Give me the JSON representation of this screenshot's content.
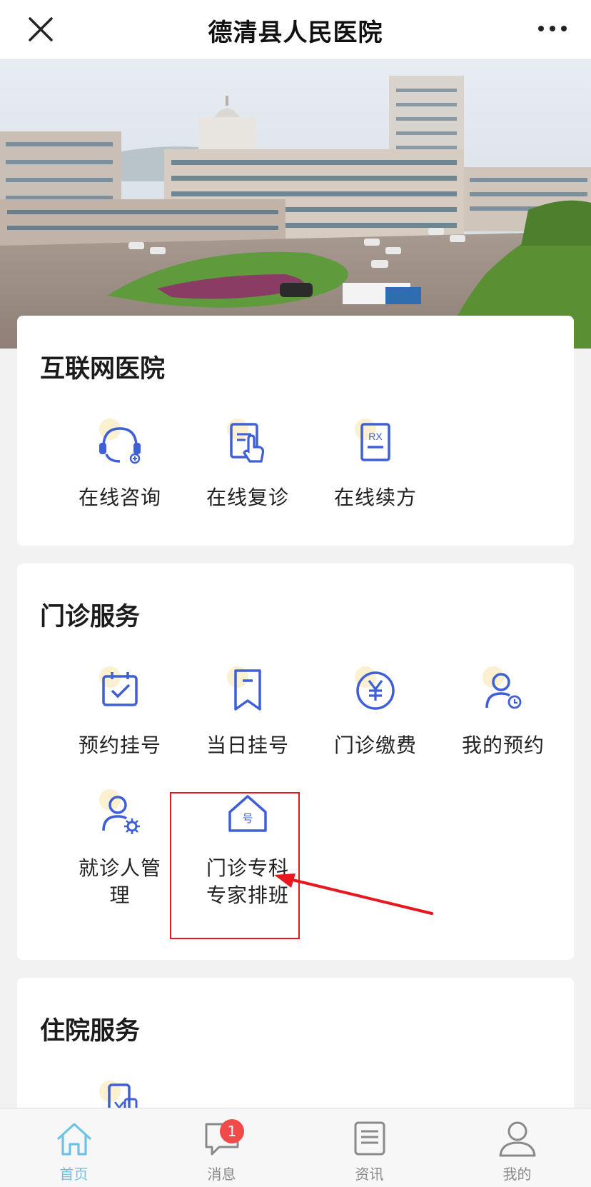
{
  "header": {
    "title": "德清县人民医院",
    "close_icon": "close-icon",
    "more_icon": "more-icon"
  },
  "banner": {
    "alt": "hospital-building-photo"
  },
  "internet_hospital": {
    "title": "互联网医院",
    "items": [
      {
        "label": "在线咨询",
        "icon": "headset-icon"
      },
      {
        "label": "在线复诊",
        "icon": "document-touch-icon"
      },
      {
        "label": "在线续方",
        "icon": "prescription-rx-icon"
      }
    ]
  },
  "outpatient": {
    "title": "门诊服务",
    "items": [
      {
        "label": "预约挂号",
        "icon": "calendar-check-icon"
      },
      {
        "label": "当日挂号",
        "icon": "bookmark-icon"
      },
      {
        "label": "门诊缴费",
        "icon": "yuan-coin-icon"
      },
      {
        "label": "我的预约",
        "icon": "user-clock-icon"
      },
      {
        "label": "就诊人管理",
        "icon": "user-gear-icon"
      },
      {
        "label": "门诊专科专家排班",
        "icon": "house-number-icon",
        "glyph": "号"
      }
    ]
  },
  "inpatient": {
    "title": "住院服务",
    "items": [
      {
        "icon": "phone-yuan-icon"
      }
    ]
  },
  "tabbar": {
    "tabs": [
      {
        "label": "首页",
        "icon": "home-icon",
        "active": true
      },
      {
        "label": "消息",
        "icon": "message-icon",
        "badge": "1"
      },
      {
        "label": "资讯",
        "icon": "news-icon"
      },
      {
        "label": "我的",
        "icon": "user-icon"
      }
    ]
  },
  "colors": {
    "icon_blue": "#3f5fd6",
    "tab_active": "#6fc2e7",
    "badge_red": "#f24a4a",
    "highlight_red": "#e8171e"
  }
}
